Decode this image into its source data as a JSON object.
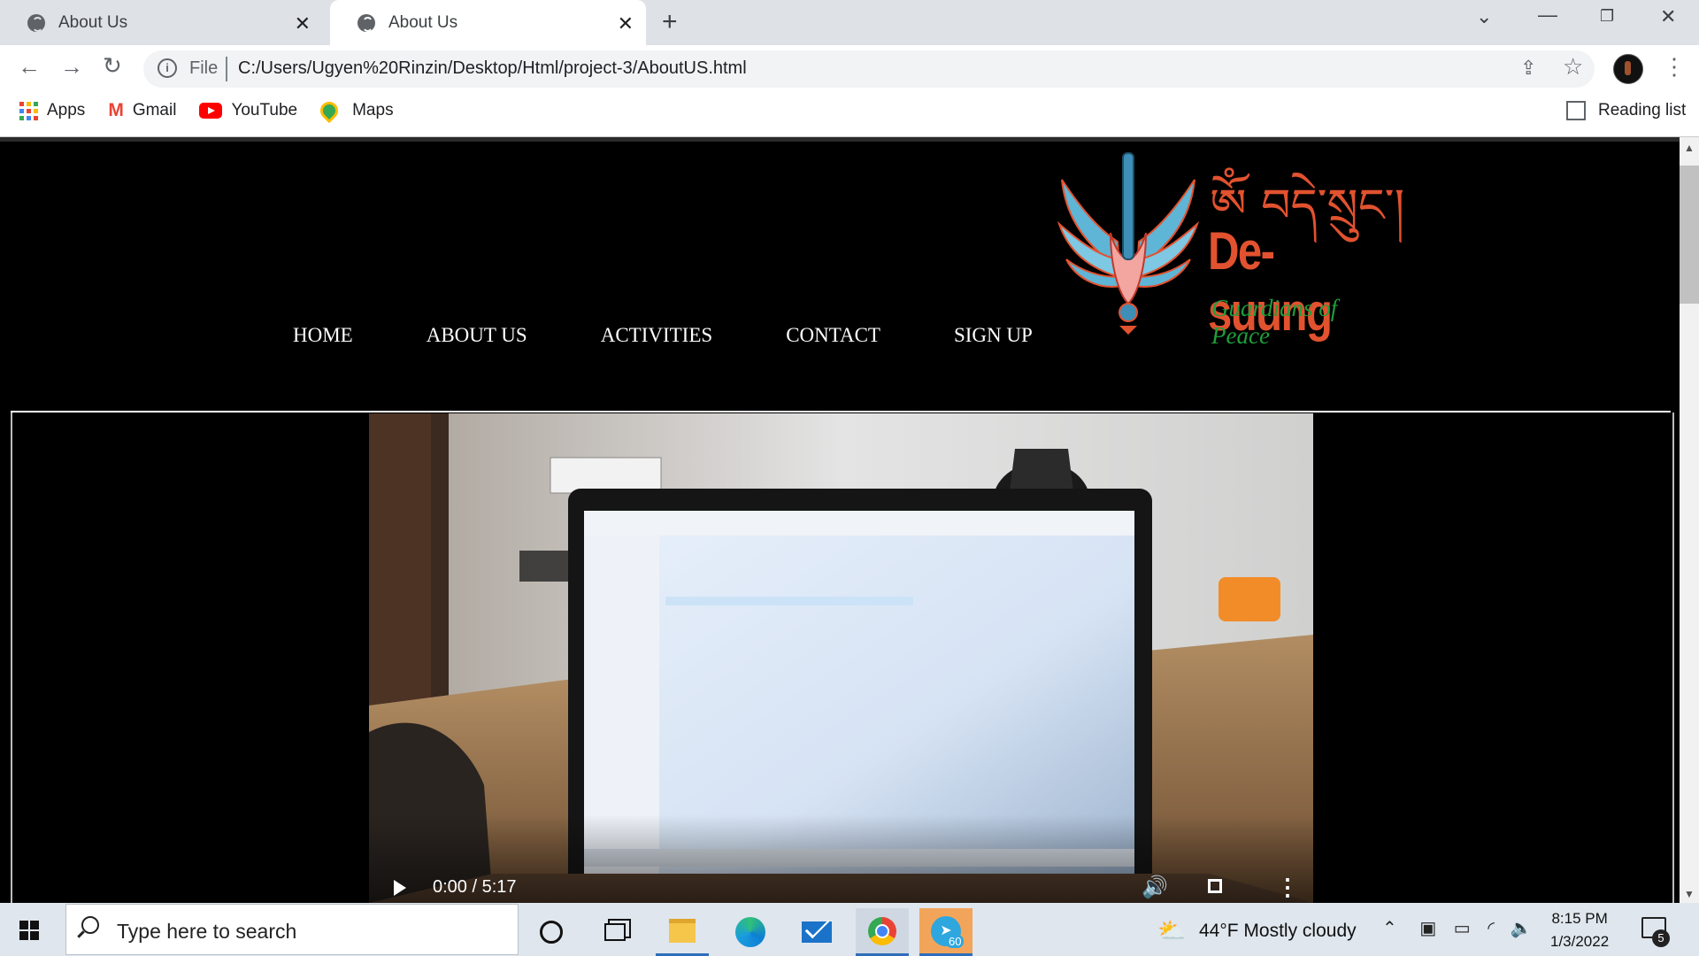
{
  "browser": {
    "tabs": [
      {
        "title": "About Us",
        "active": false
      },
      {
        "title": "About Us",
        "active": true
      }
    ],
    "new_tab_symbol": "+",
    "address": {
      "scheme_chip": "File",
      "url": "C:/Users/Ugyen%20Rinzin/Desktop/Html/project-3/AboutUS.html"
    },
    "bookmarks": [
      {
        "label": "Apps",
        "icon": "apps-grid-icon"
      },
      {
        "label": "Gmail",
        "icon": "gmail-icon"
      },
      {
        "label": "YouTube",
        "icon": "youtube-icon"
      },
      {
        "label": "Maps",
        "icon": "maps-pin-icon"
      }
    ],
    "reading_list_label": "Reading list"
  },
  "site": {
    "nav": [
      "HOME",
      "ABOUT US",
      "ACTIVITIES",
      "CONTACT",
      "SIGN UP"
    ],
    "logo": {
      "script_text": "ༀ བདེ་སྲུང་།",
      "name": "De-suung",
      "tagline": "Guardians of Peace",
      "name_color": "#e2522f",
      "tagline_color": "#1e9e3b"
    },
    "video": {
      "time": "0:00 / 5:17",
      "progress": 0
    }
  },
  "taskbar": {
    "search_placeholder": "Type here to search",
    "telegram_badge": "60",
    "weather": "44°F  Mostly cloudy",
    "time": "8:15 PM",
    "date": "1/3/2022",
    "notification_count": "5"
  }
}
